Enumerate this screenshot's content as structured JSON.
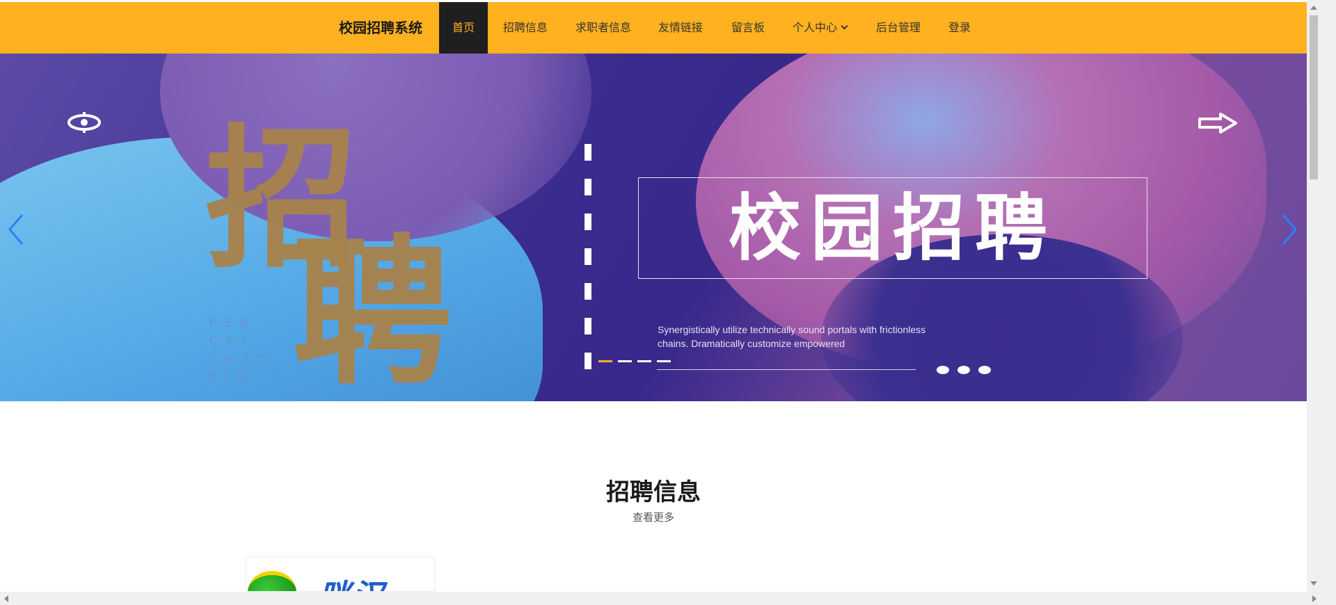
{
  "nav": {
    "brand": "校园招聘系统",
    "items": [
      {
        "label": "首页",
        "active": true
      },
      {
        "label": "招聘信息"
      },
      {
        "label": "求职者信息"
      },
      {
        "label": "友情链接"
      },
      {
        "label": "留言板"
      },
      {
        "label": "个人中心",
        "dropdown": true
      },
      {
        "label": "后台管理"
      },
      {
        "label": "登录"
      }
    ]
  },
  "banner": {
    "headline": "校园招聘",
    "big_chars": [
      "招",
      "聘"
    ],
    "pinyin": [
      "PEN",
      "CAI",
      "ZHAO",
      "PIN"
    ],
    "blurb": "Synergistically utilize technically sound portals with frictionless chains. Dramatically customize empowered",
    "colors": {
      "accent": "#ffb11f",
      "gold": "#a8824b",
      "purple": "#3b2c8f"
    }
  },
  "section": {
    "title": "招聘信息",
    "more": "查看更多"
  },
  "card": {
    "logo_text": "咪汉"
  },
  "icons": {
    "prev": "chevron-left-icon",
    "next": "chevron-right-icon",
    "logo": "eye-logo-icon",
    "arrow": "arrow-right-icon"
  }
}
